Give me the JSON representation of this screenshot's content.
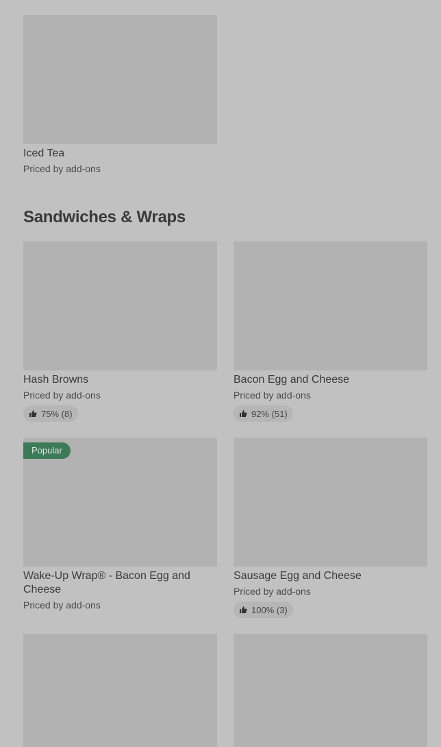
{
  "top_item": {
    "name": "Iced Tea",
    "price": "Priced by add-ons"
  },
  "section": {
    "title": "Sandwiches & Wraps"
  },
  "items": [
    {
      "name": "Hash Browns",
      "price": "Priced by add-ons",
      "rating": "75% (8)"
    },
    {
      "name": "Bacon Egg and Cheese",
      "price": "Priced by add-ons",
      "rating": "92% (51)"
    },
    {
      "name": "Wake-Up Wrap® - Bacon Egg and Cheese",
      "price": "Priced by add-ons",
      "badge": "Popular"
    },
    {
      "name": "Sausage Egg and Cheese",
      "price": "Priced by add-ons",
      "rating": "100% (3)"
    }
  ],
  "icons": {
    "rating": "thumbs-up-icon"
  },
  "colors": {
    "background": "#c1c1c1",
    "placeholder": "#b2b2b2",
    "badge": "#3d7a57"
  }
}
